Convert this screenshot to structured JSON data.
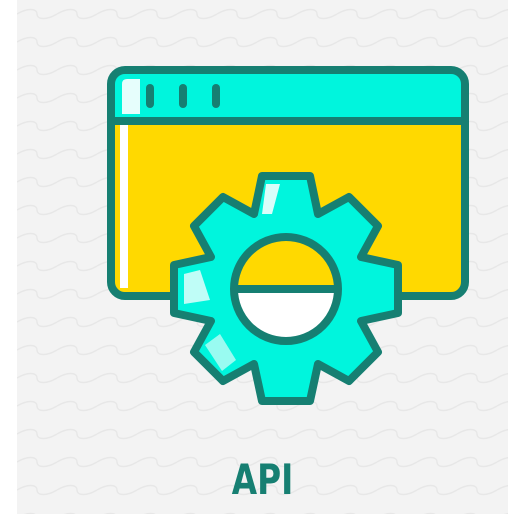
{
  "caption": {
    "label": "API"
  },
  "icons": {
    "main": "api-gear-window-icon",
    "window": "browser-window-icon",
    "gear": "gear-icon"
  },
  "colors": {
    "background": "#f3f3f3",
    "outline": "#167f72",
    "cyan": "#00f5dd",
    "yellow": "#ffd900",
    "highlight": "#ffffff"
  }
}
